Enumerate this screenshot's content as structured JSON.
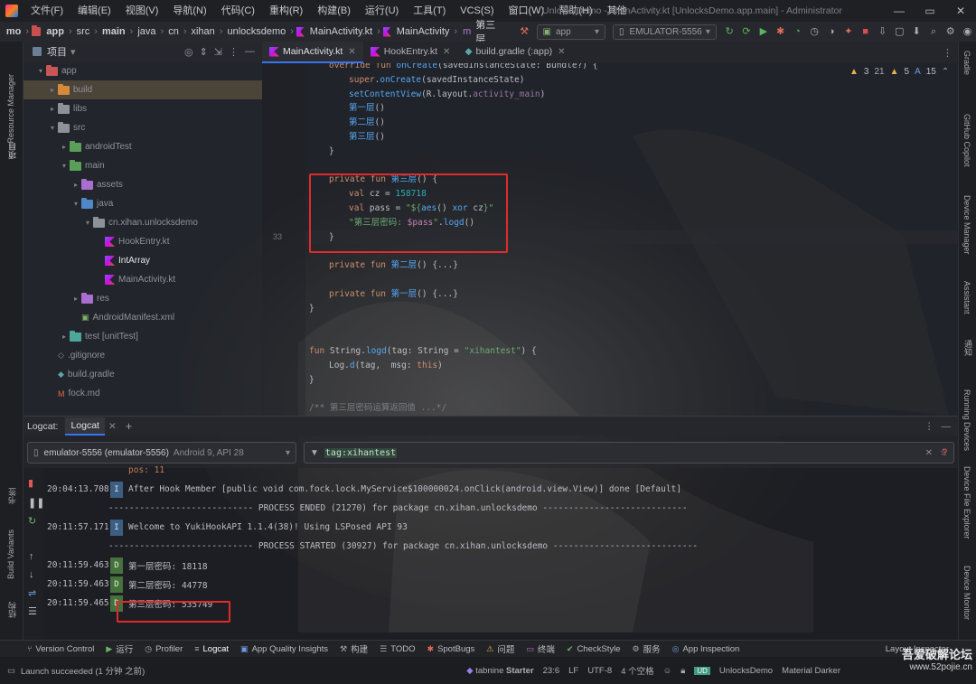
{
  "menu": [
    "文件(F)",
    "编辑(E)",
    "视图(V)",
    "导航(N)",
    "代码(C)",
    "重构(R)",
    "构建(B)",
    "运行(U)",
    "工具(T)",
    "VCS(S)",
    "窗口(W)",
    "帮助(H)",
    "其他"
  ],
  "window_title": "UnlocksDemo - MainActivity.kt [UnlocksDemo.app.main] - Administrator",
  "breadcrumb": [
    "mo",
    "app",
    "src",
    "main",
    "java",
    "cn",
    "xihan",
    "unlocksdemo",
    "MainActivity.kt",
    "MainActivity",
    "第三层"
  ],
  "run_config": "app",
  "device": "EMULATOR-5556",
  "left_strip": {
    "resource_manager": "Resource Manager",
    "project": "项目",
    "bookmarks": "书签",
    "build_variants": "Build Variants",
    "structure": "结构"
  },
  "project_panel": {
    "title": "项目",
    "tree": [
      {
        "label": "app",
        "depth": 1,
        "arrow": "▾",
        "kind": "folder-red"
      },
      {
        "label": "build",
        "depth": 2,
        "arrow": "▸",
        "kind": "folder-orange",
        "selected": true
      },
      {
        "label": "libs",
        "depth": 2,
        "arrow": "▸",
        "kind": "folder-grey"
      },
      {
        "label": "src",
        "depth": 2,
        "arrow": "▾",
        "kind": "folder-grey"
      },
      {
        "label": "androidTest",
        "depth": 3,
        "arrow": "▸",
        "kind": "folder-green"
      },
      {
        "label": "main",
        "depth": 3,
        "arrow": "▾",
        "kind": "folder-green"
      },
      {
        "label": "assets",
        "depth": 4,
        "arrow": "▸",
        "kind": "folder-purple"
      },
      {
        "label": "java",
        "depth": 4,
        "arrow": "▾",
        "kind": "folder-blue"
      },
      {
        "label": "cn.xihan.unlocksdemo",
        "depth": 5,
        "arrow": "▾",
        "kind": "folder-grey"
      },
      {
        "label": "HookEntry.kt",
        "depth": 6,
        "arrow": "",
        "kind": "kt"
      },
      {
        "label": "IntArray",
        "depth": 6,
        "arrow": "",
        "kind": "kt"
      },
      {
        "label": "MainActivity.kt",
        "depth": 6,
        "arrow": "",
        "kind": "kt"
      },
      {
        "label": "res",
        "depth": 4,
        "arrow": "▸",
        "kind": "folder-purple"
      },
      {
        "label": "AndroidManifest.xml",
        "depth": 4,
        "arrow": "",
        "kind": "android"
      },
      {
        "label": "test [unitTest]",
        "depth": 3,
        "arrow": "▸",
        "kind": "folder-teal"
      },
      {
        "label": ".gitignore",
        "depth": 2,
        "arrow": "",
        "kind": "file"
      },
      {
        "label": "build.gradle",
        "depth": 2,
        "arrow": "",
        "kind": "gradle"
      },
      {
        "label": "fock.md",
        "depth": 2,
        "arrow": "",
        "kind": "md"
      }
    ]
  },
  "editor_tabs": [
    {
      "label": "MainActivity.kt",
      "active": true
    },
    {
      "label": "HookEntry.kt",
      "active": false
    },
    {
      "label": "build.gradle (:app)",
      "active": false
    }
  ],
  "editor": {
    "inspection": {
      "warnings": "3",
      "weak_warnings": "21",
      "typos": "5",
      "other": "15"
    },
    "current_line_number": "33",
    "lines": [
      {
        "row": 0,
        "indent": 1,
        "html": "<span class='kw'>override fun</span> <span class='fn'>onCreate</span>(savedInstanceState: Bundle?) {"
      },
      {
        "row": 1,
        "indent": 2,
        "html": "<span class='kw'>super</span>.<span class='fn'>onCreate</span>(savedInstanceState)"
      },
      {
        "row": 2,
        "indent": 2,
        "html": "<span class='fn'>setContentView</span>(R.layout.<span class='it'>activity_main</span>)"
      },
      {
        "row": 3,
        "indent": 2,
        "html": "<span class='fn'>第一层</span>()"
      },
      {
        "row": 4,
        "indent": 2,
        "html": "<span class='fn'>第二层</span>()"
      },
      {
        "row": 5,
        "indent": 2,
        "html": "<span class='fn'>第三层</span>()"
      },
      {
        "row": 6,
        "indent": 1,
        "html": "}"
      },
      {
        "row": 8,
        "indent": 1,
        "html": "<span class='kw'>private fun</span> <span class='fn'>第三层</span>() {"
      },
      {
        "row": 9,
        "indent": 2,
        "html": "<span class='kw'>val</span> cz = <span class='nm'>158718</span>"
      },
      {
        "row": 10,
        "indent": 2,
        "html": "<span class='kw'>val</span> pass = <span class='st'>\"${</span><span class='fn'>aes</span>() <span class='fn'>xor</span> cz<span class='st'>}\"</span>"
      },
      {
        "row": 11,
        "indent": 2,
        "html": "<span class='st'>\"第三层密码: </span><span class='pp'>$pass</span><span class='st'>\"</span>.<span class='fn'>logd</span>()"
      },
      {
        "row": 12,
        "indent": 1,
        "html": "}"
      },
      {
        "row": 14,
        "indent": 1,
        "html": "<span class='kw'>private fun</span> <span class='fn'>第二层</span>() {...}"
      },
      {
        "row": 16,
        "indent": 1,
        "html": "<span class='kw'>private fun</span> <span class='fn'>第一层</span>() {...}"
      },
      {
        "row": 17,
        "indent": 0,
        "html": "}"
      },
      {
        "row": 20,
        "indent": 0,
        "html": "<span class='kw'>fun</span> String.<span class='fn'>logd</span>(tag: String = <span class='st'>\"xihantest\"</span>) {"
      },
      {
        "row": 21,
        "indent": 1,
        "html": "Log.<span class='fn'>d</span>(tag,  msg: <span class='kw'>this</span>)"
      },
      {
        "row": 22,
        "indent": 0,
        "html": "}"
      },
      {
        "row": 24,
        "indent": 0,
        "html": "<span class='cm'>/** 第三层密码运算返回值 ...*/</span>"
      }
    ]
  },
  "right_strip": [
    "Gradle",
    "GitHub Copilot",
    "Device Manager",
    "Assistant",
    "通知",
    "Running Devices",
    "Device File Explorer",
    "Device Monitor"
  ],
  "logcat": {
    "label": "Logcat:",
    "tab": "Logcat",
    "device_selector": "emulator-5556 (emulator-5556)",
    "device_detail": "Android 9, API 28",
    "filter": "tag:xihantest",
    "lines": [
      {
        "ts": "",
        "level": "",
        "msg": "pos: 11",
        "partial": true
      },
      {
        "ts": "20:04:13.708",
        "level": "I",
        "msg": "After Hook Member [public void com.fock.lock.MyService$100000024.onClick(android.view.View)] done [Default]"
      },
      {
        "ts": "",
        "level": "",
        "msg": "---------------------------- PROCESS ENDED (21270) for package cn.xihan.unlocksdemo ----------------------------"
      },
      {
        "ts": "20:11:57.171",
        "level": "I",
        "msg": "Welcome to YukiHookAPI 1.1.4(38)! Using LSPosed API 93"
      },
      {
        "ts": "",
        "level": "",
        "msg": "---------------------------- PROCESS STARTED (30927) for package cn.xihan.unlocksdemo ----------------------------"
      },
      {
        "ts": "20:11:59.463",
        "level": "D",
        "msg": "第一层密码: 18118"
      },
      {
        "ts": "20:11:59.463",
        "level": "D",
        "msg": "第二层密码: 44778"
      },
      {
        "ts": "20:11:59.465",
        "level": "D",
        "msg": "第三层密码: 535749"
      }
    ]
  },
  "tool_tabs": [
    "Version Control",
    "运行",
    "Profiler",
    "Logcat",
    "App Quality Insights",
    "构建",
    "TODO",
    "SpotBugs",
    "问题",
    "终端",
    "CheckStyle",
    "服务",
    "App Inspection"
  ],
  "tool_tabs_right": "Layout Inspector",
  "status": {
    "message": "Launch succeeded (1 分钟 之前)",
    "plugin": "tabnine",
    "plugin_suffix": "Starter",
    "position": "23:6",
    "line_sep": "LF",
    "encoding": "UTF-8",
    "indent": "4 个空格",
    "project": "UnlocksDemo",
    "theme": "Material Darker"
  },
  "watermark": {
    "line1": "吾爱破解论坛",
    "line2": "www.52pojie.cn"
  },
  "colors": {
    "accent": "#3574f0",
    "highlight_box": "#e02b2b",
    "log_info": "#3b5e82",
    "log_debug": "#45713c"
  }
}
